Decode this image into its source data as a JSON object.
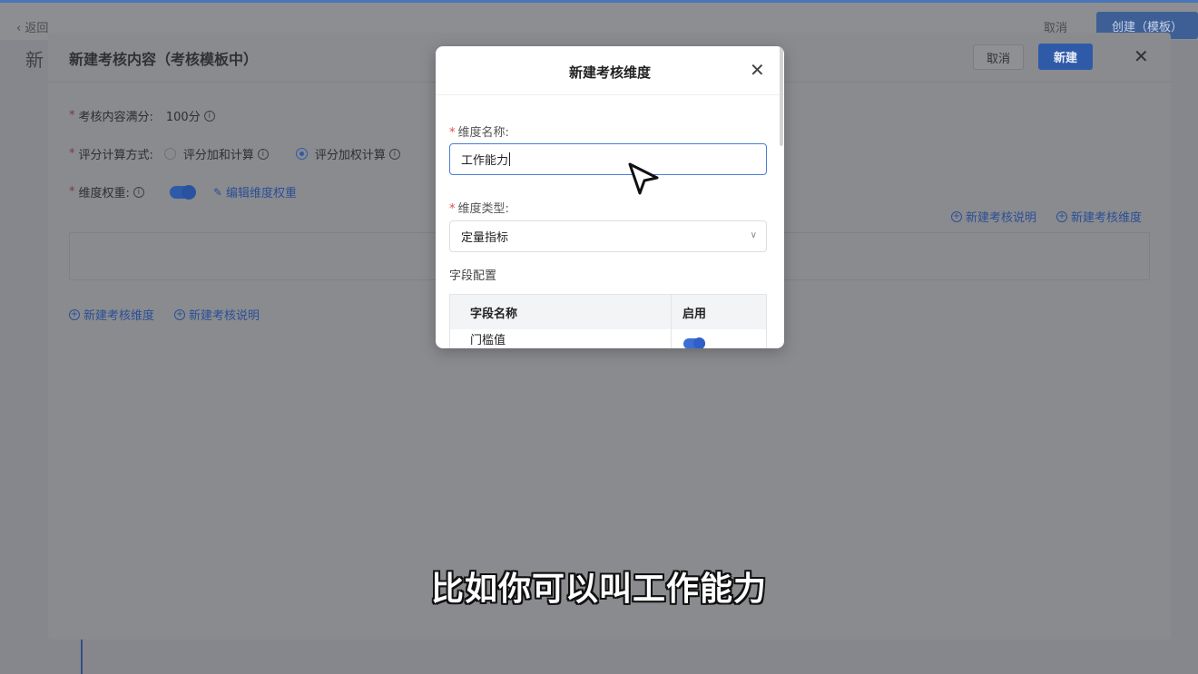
{
  "background": {
    "back_label": "返回",
    "cancel_label": "取消",
    "create_label": "创建（模板）",
    "title_fragment": "新"
  },
  "drawer": {
    "title": "新建考核内容（考核模板中）",
    "cancel_label": "取消",
    "new_label": "新建",
    "full_score_label": "考核内容满分:",
    "full_score_value": "100分",
    "calc_method_label": "评分计算方式:",
    "calc_option_sum": "评分加和计算",
    "calc_option_weighted": "评分加权计算",
    "dimension_weight_label": "维度权重:",
    "edit_weight_link": "编辑维度权重",
    "right_links": [
      "新建考核说明",
      "新建考核维度"
    ],
    "bottom_links": [
      "新建考核维度",
      "新建考核说明"
    ]
  },
  "modal": {
    "title": "新建考核维度",
    "name_label": "维度名称:",
    "name_value": "工作能力",
    "type_label": "维度类型:",
    "type_value": "定量指标",
    "field_config_label": "字段配置",
    "table": {
      "headers": [
        "字段名称",
        "启用"
      ],
      "rows": [
        [
          "门槛值",
          true
        ]
      ]
    }
  },
  "subtitle": "比如你可以叫工作能力",
  "colors": {
    "primary": "#2f5aa8",
    "input_border": "#4a7fd8",
    "required": "#e54b4b"
  }
}
